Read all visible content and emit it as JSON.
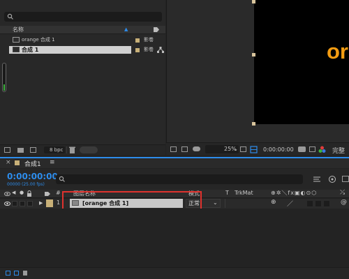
{
  "project": {
    "column_name": "名称",
    "items": [
      {
        "name": "orange 合成 1",
        "type_label": "影卷"
      },
      {
        "name": "合成 1",
        "type_label": "影卷"
      }
    ],
    "bpc": "8 bpc"
  },
  "viewer": {
    "canvas_text": "or",
    "zoom": "25%",
    "timecode": "0:00:00:00",
    "quality": "完整"
  },
  "timeline": {
    "tab_label": "合成1",
    "tab_close": "≡",
    "current_time": "0:00:00:00",
    "frame_info": "00000 (25.00 fps)",
    "columns": {
      "layer_name": "图层名称",
      "mode": "模式",
      "t": "T",
      "trkmat": "TrkMat"
    },
    "layers": [
      {
        "number": "1",
        "name": "[orange 合成 1]",
        "mode": "正常"
      }
    ]
  },
  "colors": {
    "accent": "#2d8ceb",
    "highlight": "#e0322e",
    "label": "#c8b078",
    "orange_text": "#f39c12"
  }
}
